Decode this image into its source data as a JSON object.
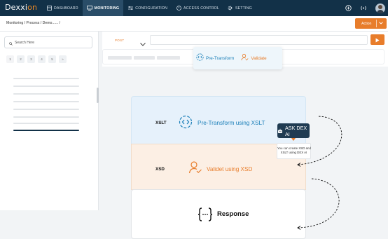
{
  "app": {
    "logo_text": "Dex",
    "logo_mid": "xi",
    "logo_accent": "on"
  },
  "nav": [
    {
      "label": "DASHBOARD",
      "icon": "dashboard-icon"
    },
    {
      "label": "MONITORING",
      "icon": "monitor-icon",
      "active": true
    },
    {
      "label": "CONFIGURATION",
      "icon": "sliders-icon"
    },
    {
      "label": "ACCESS CONTROL",
      "icon": "access-icon"
    },
    {
      "label": "SETTING",
      "icon": "gear-icon"
    }
  ],
  "breadcrumb": "Monitoring /  Process / Demo...... /",
  "action": {
    "label": "Action"
  },
  "sidebar": {
    "search_placeholder": "Search Here",
    "pages": [
      "1",
      "2",
      "3",
      "4",
      "5",
      "»"
    ]
  },
  "request": {
    "method": "POST"
  },
  "flow": {
    "pre_transform": "Pre-Transform",
    "validate": "Validate"
  },
  "rows": {
    "xslt": {
      "label": "XSLT",
      "title": "Pre-Transform using XSLT"
    },
    "xsd": {
      "label": "XSD",
      "title": "Validet using XSD"
    },
    "response": {
      "title": "Response"
    }
  },
  "ask": {
    "label": "ASK DEX AI",
    "tooltip_line1": "You can create XSD  and",
    "tooltip_line2": "XSLT using DEX AI"
  },
  "colors": {
    "navy": "#123148",
    "orange": "#e87d2b",
    "blue": "#1b7fb8"
  }
}
